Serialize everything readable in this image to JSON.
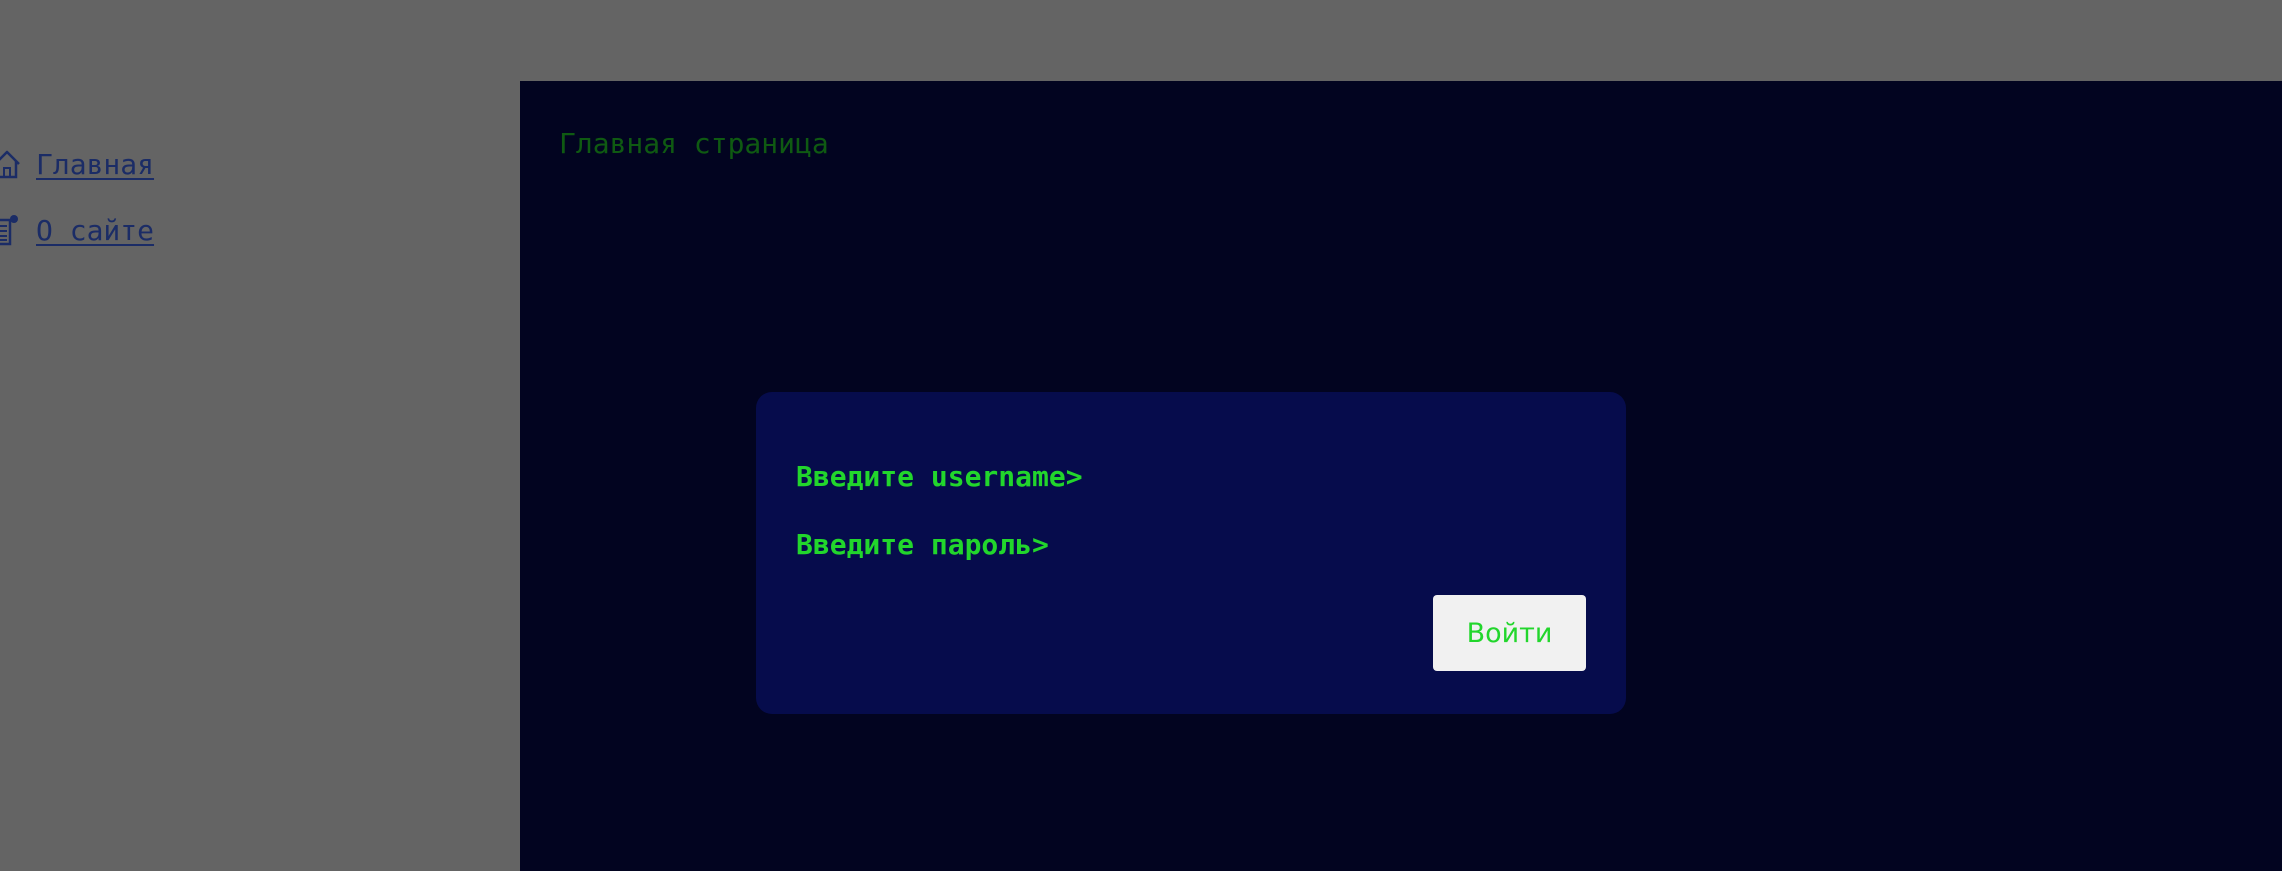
{
  "sidebar": {
    "items": [
      {
        "label": "Главная",
        "icon": "home-icon"
      },
      {
        "label": "О сайте",
        "icon": "info-document-icon"
      }
    ]
  },
  "main": {
    "title": "Главная страница",
    "login_dialog": {
      "username_prompt": "Введите username>",
      "password_prompt": "Введите пароль>",
      "login_button": "Войти"
    }
  },
  "colors": {
    "backdrop": "#646464",
    "terminal_bg": "#020420",
    "dialog_bg": "#060c4c",
    "prompt_green": "#22d62c",
    "title_green": "#0f5a12",
    "link_blue": "#1b2c66",
    "button_bg": "#f1f1f1"
  }
}
